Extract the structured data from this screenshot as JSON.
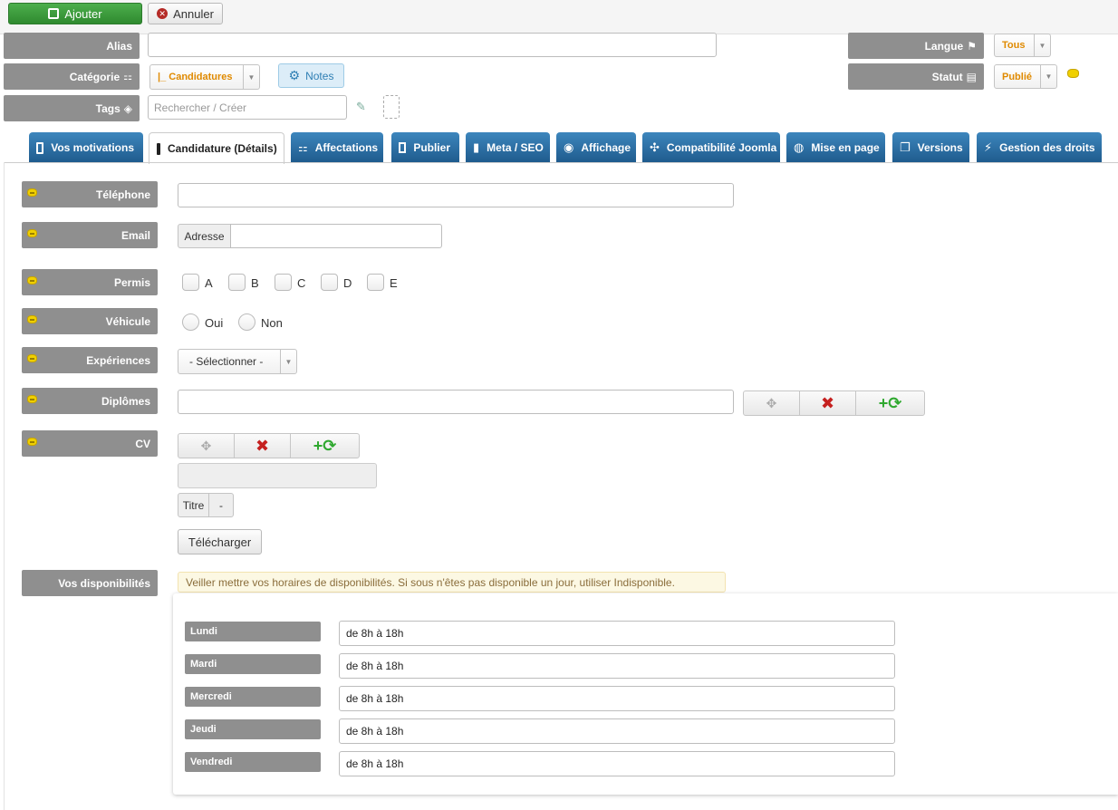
{
  "toolbar": {
    "add_label": "Ajouter",
    "cancel_label": "Annuler"
  },
  "header": {
    "alias_label": "Alias",
    "alias_value": "",
    "category_label": "Catégorie",
    "category_value": "|_ Candidatures",
    "notes_label": "Notes",
    "tags_label": "Tags",
    "tags_placeholder": "Rechercher / Créer",
    "language_label": "Langue",
    "language_value": "Tous",
    "status_label": "Statut",
    "status_value": "Publié"
  },
  "tabs": [
    {
      "label": "Vos motivations",
      "active": false
    },
    {
      "label": "Candidature (Détails)",
      "active": true
    },
    {
      "label": "Affectations",
      "active": false
    },
    {
      "label": "Publier",
      "active": false
    },
    {
      "label": "Meta / SEO",
      "active": false
    },
    {
      "label": "Affichage",
      "active": false
    },
    {
      "label": "Compatibilité Joomla",
      "active": false
    },
    {
      "label": "Mise en page",
      "active": false
    },
    {
      "label": "Versions",
      "active": false
    },
    {
      "label": "Gestion des droits",
      "active": false
    }
  ],
  "form": {
    "phone_label": "Téléphone",
    "phone_value": "",
    "email_label": "Email",
    "email_prefix": "Adresse",
    "email_value": "",
    "license_label": "Permis",
    "license_options": [
      "A",
      "B",
      "C",
      "D",
      "E"
    ],
    "vehicle_label": "Véhicule",
    "vehicle_options": [
      "Oui",
      "Non"
    ],
    "experience_label": "Expériences",
    "experience_value": "- Sélectionner -",
    "diploma_label": "Diplômes",
    "diploma_value": "",
    "cv_label": "CV",
    "cv_title_label": "Titre",
    "cv_title_value": "-",
    "upload_label": "Télécharger",
    "availability_label": "Vos disponibilités",
    "availability_notice": "Veiller mettre vos horaires de disponibilités. Si sous n'êtes pas disponible un jour, utiliser Indisponible.",
    "days": [
      {
        "label": "Lundi",
        "value": "de 8h à 18h"
      },
      {
        "label": "Mardi",
        "value": "de 8h à 18h"
      },
      {
        "label": "Mercredi",
        "value": "de 8h à 18h"
      },
      {
        "label": "Jeudi",
        "value": "de 8h à 18h"
      },
      {
        "label": "Vendredi",
        "value": "de 8h à 18h"
      }
    ]
  }
}
